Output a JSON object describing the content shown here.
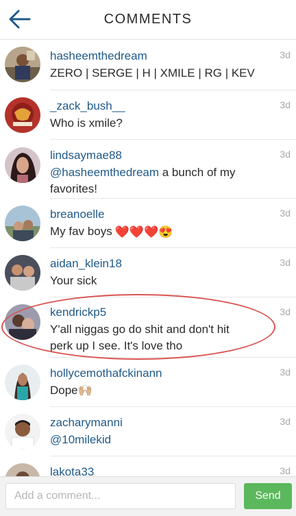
{
  "header": {
    "title": "COMMENTS"
  },
  "comments": [
    {
      "username": "hasheemthedream",
      "text": "ZERO | SERGE | H | XMILE | RG | KEV",
      "time": "3d"
    },
    {
      "username": "_zack_bush__",
      "text": "Who is xmile?",
      "time": "3d"
    },
    {
      "username": "lindsaymae88",
      "mention": "@hasheemthedream",
      "text": " a bunch of my",
      "text2": "favorites!",
      "time": "3d"
    },
    {
      "username": "breanoelle",
      "text": "My fav boys",
      "emoji": "❤️❤️❤️😍",
      "time": "3d"
    },
    {
      "username": "aidan_klein18",
      "text": "Your sick",
      "time": "3d"
    },
    {
      "username": "kendrickp5",
      "text": "Y'all niggas go do shit and don't hit",
      "text2": "perk up I see. It's love tho",
      "time": "3d"
    },
    {
      "username": "hollycemothafckinann",
      "text": "Dope🙌🏼",
      "time": "3d"
    },
    {
      "username": "zacharymanni",
      "mention": "@10milekid",
      "time": "3d"
    },
    {
      "username": "lakota33",
      "time": "3d"
    }
  ],
  "footer": {
    "placeholder": "Add a comment...",
    "send_label": "Send"
  },
  "colors": {
    "username": "#1f5a8a",
    "send": "#5cb85c",
    "highlight": "#d9534f"
  }
}
